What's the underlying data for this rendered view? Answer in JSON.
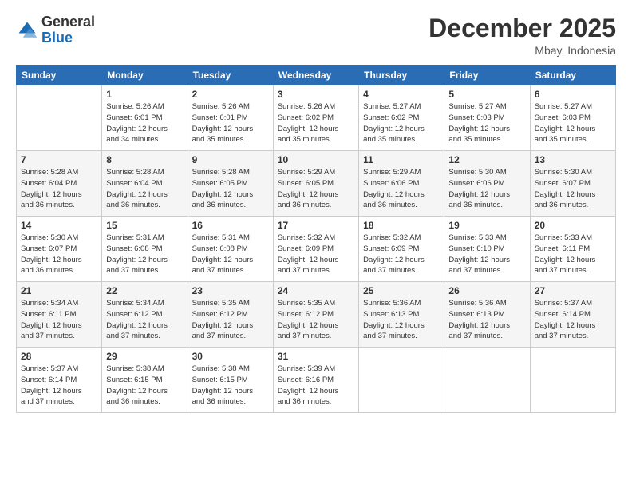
{
  "logo": {
    "line1": "General",
    "line2": "Blue"
  },
  "title": "December 2025",
  "location": "Mbay, Indonesia",
  "days_header": [
    "Sunday",
    "Monday",
    "Tuesday",
    "Wednesday",
    "Thursday",
    "Friday",
    "Saturday"
  ],
  "weeks": [
    [
      {
        "num": "",
        "info": ""
      },
      {
        "num": "1",
        "info": "Sunrise: 5:26 AM\nSunset: 6:01 PM\nDaylight: 12 hours\nand 34 minutes."
      },
      {
        "num": "2",
        "info": "Sunrise: 5:26 AM\nSunset: 6:01 PM\nDaylight: 12 hours\nand 35 minutes."
      },
      {
        "num": "3",
        "info": "Sunrise: 5:26 AM\nSunset: 6:02 PM\nDaylight: 12 hours\nand 35 minutes."
      },
      {
        "num": "4",
        "info": "Sunrise: 5:27 AM\nSunset: 6:02 PM\nDaylight: 12 hours\nand 35 minutes."
      },
      {
        "num": "5",
        "info": "Sunrise: 5:27 AM\nSunset: 6:03 PM\nDaylight: 12 hours\nand 35 minutes."
      },
      {
        "num": "6",
        "info": "Sunrise: 5:27 AM\nSunset: 6:03 PM\nDaylight: 12 hours\nand 35 minutes."
      }
    ],
    [
      {
        "num": "7",
        "info": "Sunrise: 5:28 AM\nSunset: 6:04 PM\nDaylight: 12 hours\nand 36 minutes."
      },
      {
        "num": "8",
        "info": "Sunrise: 5:28 AM\nSunset: 6:04 PM\nDaylight: 12 hours\nand 36 minutes."
      },
      {
        "num": "9",
        "info": "Sunrise: 5:28 AM\nSunset: 6:05 PM\nDaylight: 12 hours\nand 36 minutes."
      },
      {
        "num": "10",
        "info": "Sunrise: 5:29 AM\nSunset: 6:05 PM\nDaylight: 12 hours\nand 36 minutes."
      },
      {
        "num": "11",
        "info": "Sunrise: 5:29 AM\nSunset: 6:06 PM\nDaylight: 12 hours\nand 36 minutes."
      },
      {
        "num": "12",
        "info": "Sunrise: 5:30 AM\nSunset: 6:06 PM\nDaylight: 12 hours\nand 36 minutes."
      },
      {
        "num": "13",
        "info": "Sunrise: 5:30 AM\nSunset: 6:07 PM\nDaylight: 12 hours\nand 36 minutes."
      }
    ],
    [
      {
        "num": "14",
        "info": "Sunrise: 5:30 AM\nSunset: 6:07 PM\nDaylight: 12 hours\nand 36 minutes."
      },
      {
        "num": "15",
        "info": "Sunrise: 5:31 AM\nSunset: 6:08 PM\nDaylight: 12 hours\nand 37 minutes."
      },
      {
        "num": "16",
        "info": "Sunrise: 5:31 AM\nSunset: 6:08 PM\nDaylight: 12 hours\nand 37 minutes."
      },
      {
        "num": "17",
        "info": "Sunrise: 5:32 AM\nSunset: 6:09 PM\nDaylight: 12 hours\nand 37 minutes."
      },
      {
        "num": "18",
        "info": "Sunrise: 5:32 AM\nSunset: 6:09 PM\nDaylight: 12 hours\nand 37 minutes."
      },
      {
        "num": "19",
        "info": "Sunrise: 5:33 AM\nSunset: 6:10 PM\nDaylight: 12 hours\nand 37 minutes."
      },
      {
        "num": "20",
        "info": "Sunrise: 5:33 AM\nSunset: 6:11 PM\nDaylight: 12 hours\nand 37 minutes."
      }
    ],
    [
      {
        "num": "21",
        "info": "Sunrise: 5:34 AM\nSunset: 6:11 PM\nDaylight: 12 hours\nand 37 minutes."
      },
      {
        "num": "22",
        "info": "Sunrise: 5:34 AM\nSunset: 6:12 PM\nDaylight: 12 hours\nand 37 minutes."
      },
      {
        "num": "23",
        "info": "Sunrise: 5:35 AM\nSunset: 6:12 PM\nDaylight: 12 hours\nand 37 minutes."
      },
      {
        "num": "24",
        "info": "Sunrise: 5:35 AM\nSunset: 6:12 PM\nDaylight: 12 hours\nand 37 minutes."
      },
      {
        "num": "25",
        "info": "Sunrise: 5:36 AM\nSunset: 6:13 PM\nDaylight: 12 hours\nand 37 minutes."
      },
      {
        "num": "26",
        "info": "Sunrise: 5:36 AM\nSunset: 6:13 PM\nDaylight: 12 hours\nand 37 minutes."
      },
      {
        "num": "27",
        "info": "Sunrise: 5:37 AM\nSunset: 6:14 PM\nDaylight: 12 hours\nand 37 minutes."
      }
    ],
    [
      {
        "num": "28",
        "info": "Sunrise: 5:37 AM\nSunset: 6:14 PM\nDaylight: 12 hours\nand 37 minutes."
      },
      {
        "num": "29",
        "info": "Sunrise: 5:38 AM\nSunset: 6:15 PM\nDaylight: 12 hours\nand 36 minutes."
      },
      {
        "num": "30",
        "info": "Sunrise: 5:38 AM\nSunset: 6:15 PM\nDaylight: 12 hours\nand 36 minutes."
      },
      {
        "num": "31",
        "info": "Sunrise: 5:39 AM\nSunset: 6:16 PM\nDaylight: 12 hours\nand 36 minutes."
      },
      {
        "num": "",
        "info": ""
      },
      {
        "num": "",
        "info": ""
      },
      {
        "num": "",
        "info": ""
      }
    ]
  ]
}
